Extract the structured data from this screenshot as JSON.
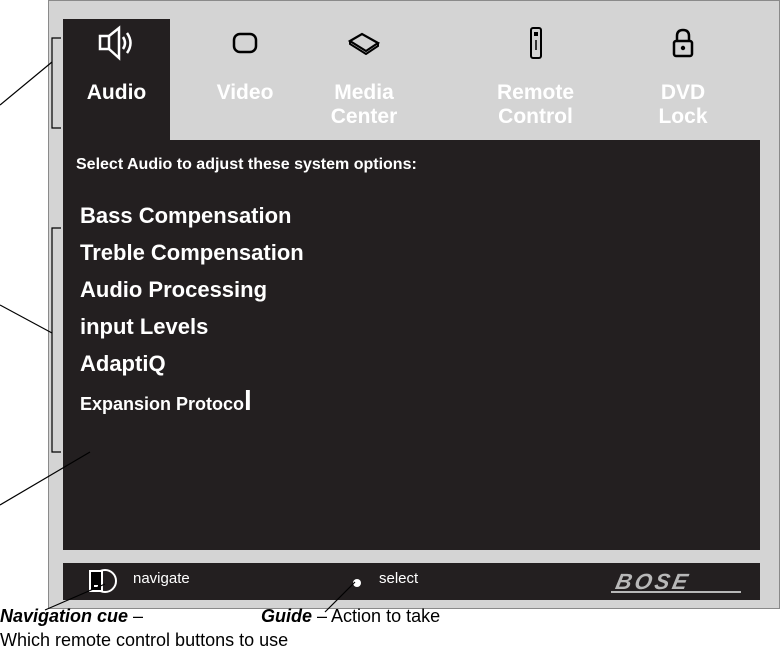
{
  "tabs": [
    {
      "label": "Audio",
      "icon": "speaker-icon",
      "active": true
    },
    {
      "label": "Video",
      "icon": "tv-screen-icon",
      "active": false
    },
    {
      "label": "Media Center",
      "icon": "media-center-icon",
      "active": false
    },
    {
      "label": "Remote Control",
      "icon": "remote-control-icon",
      "active": false
    },
    {
      "label": "DVD Lock",
      "icon": "padlock-icon",
      "active": false
    }
  ],
  "panel": {
    "prompt": "Select Audio to adjust these system options:",
    "options": [
      "Bass Compensation",
      "Treble Compensation",
      "Audio Processing",
      "input Levels",
      "AdaptiQ",
      "Expansion Protocol"
    ]
  },
  "footer": {
    "navigate_label": "navigate",
    "select_label": "select",
    "logo_text": "BOSE"
  },
  "callouts": {
    "navigation_cue_title": "Navigation cue",
    "navigation_cue_dash": " –",
    "navigation_cue_desc": "Which remote control buttons to use",
    "guide_title": "Guide",
    "guide_desc": " – Action to take"
  },
  "colors": {
    "panel": "#231f20",
    "frame": "#d4d4d4",
    "text": "#ffffff",
    "logo": "#b8b8b8"
  }
}
